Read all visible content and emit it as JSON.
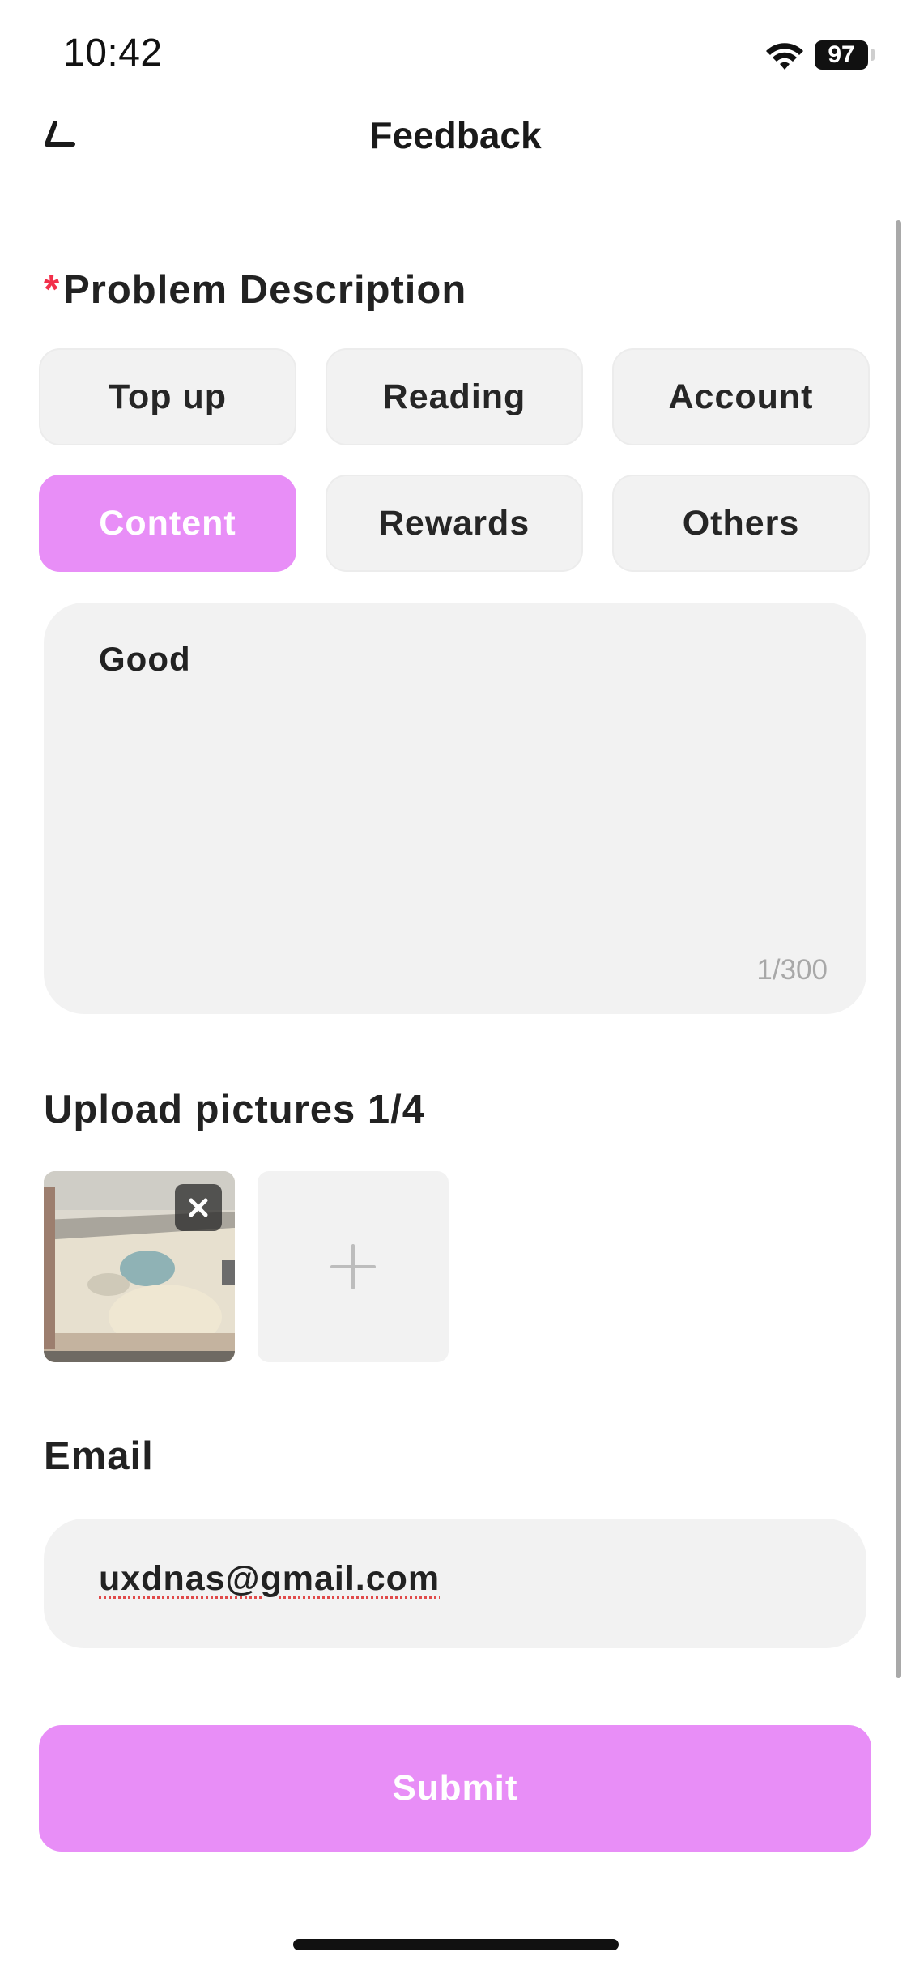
{
  "status_bar": {
    "time": "10:42",
    "battery": "97"
  },
  "nav": {
    "title": "Feedback"
  },
  "problem": {
    "required_mark": "*",
    "title": "Problem Description",
    "categories": [
      {
        "label": "Top up",
        "selected": false
      },
      {
        "label": "Reading",
        "selected": false
      },
      {
        "label": "Account",
        "selected": false
      },
      {
        "label": "Content",
        "selected": true
      },
      {
        "label": "Rewards",
        "selected": false
      },
      {
        "label": "Others",
        "selected": false
      }
    ],
    "description": "Good",
    "char_count": "1/300"
  },
  "upload": {
    "title": "Upload pictures 1/4"
  },
  "email": {
    "title": "Email",
    "value": "uxdnas@gmail.com"
  },
  "submit": {
    "label": "Submit"
  },
  "colors": {
    "accent": "#e88ef7",
    "required": "#f2304b",
    "field_background": "#f2f2f2"
  },
  "icons": {
    "back": "back-arrow-icon",
    "wifi": "wifi-icon",
    "remove": "close-icon",
    "add": "plus-icon"
  }
}
